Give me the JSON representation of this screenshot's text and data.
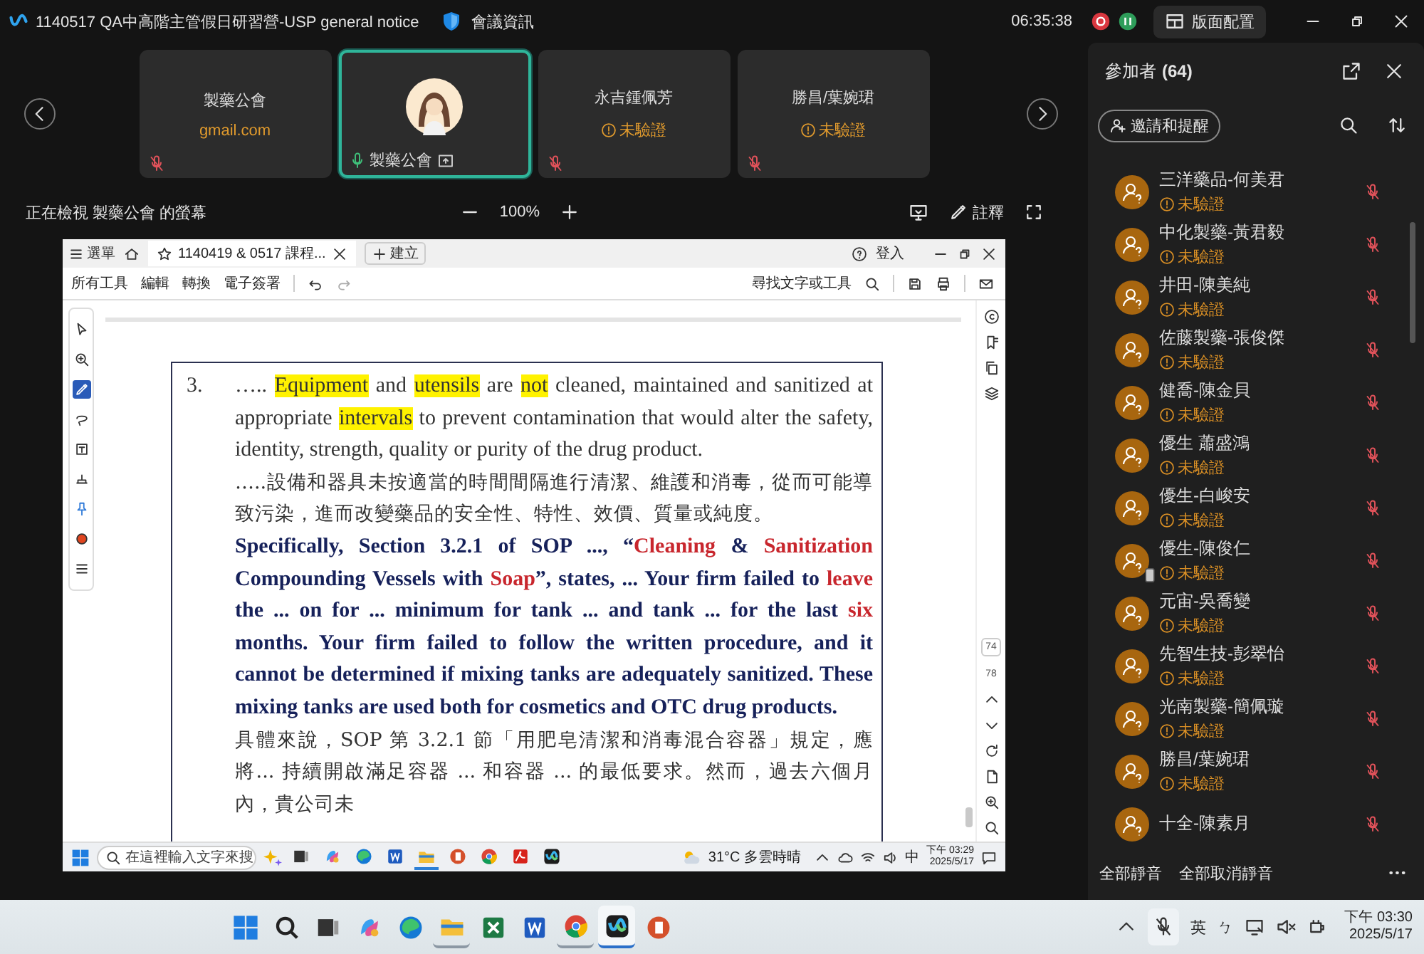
{
  "window": {
    "title": "1140517 QA中高階主管假日研習營-USP general notice",
    "meeting_info": "會議資訊",
    "timer": "06:35:38",
    "layout_button": "版面配置"
  },
  "video_strip": {
    "tiles": [
      {
        "kind": "text",
        "name": "製藥公會",
        "subtitle": "gmail.com",
        "muted": true,
        "speaking": false,
        "sharing": false
      },
      {
        "kind": "avatar",
        "name": "製藥公會",
        "muted": false,
        "speaking": true,
        "sharing": true
      },
      {
        "kind": "text",
        "name": "永吉鍾佩芳",
        "status": "未驗證",
        "muted": true,
        "speaking": false,
        "sharing": false
      },
      {
        "kind": "text",
        "name": "勝昌/葉婉珺",
        "status": "未驗證",
        "muted": true,
        "speaking": false,
        "sharing": false
      }
    ]
  },
  "share_bar": {
    "caption": "正在檢視 製藥公會 的螢幕",
    "zoom": "100%",
    "annotate_button": "註釋"
  },
  "shared_screen": {
    "viewer": {
      "menu": "選單",
      "tab": "1140419 & 0517 課程...",
      "new_tab": "建立",
      "sign_in": "登入",
      "tools": [
        "所有工具",
        "編輯",
        "轉換",
        "電子簽署"
      ],
      "find": "尋找文字或工具",
      "page_numbers": [
        "74",
        "78"
      ],
      "tool_rail": [
        {
          "kind": "cursor",
          "selected": false
        },
        {
          "kind": "zoom",
          "selected": false
        },
        {
          "kind": "pen",
          "selected": true
        },
        {
          "kind": "lasso",
          "selected": false
        },
        {
          "kind": "textbox",
          "selected": false
        },
        {
          "kind": "stamp",
          "selected": false
        },
        {
          "kind": "pin",
          "selected": false
        },
        {
          "kind": "color",
          "selected": false
        },
        {
          "kind": "menu",
          "selected": false
        }
      ]
    },
    "document": {
      "item_number": "3.",
      "paragraphs": [
        {
          "kind": "english",
          "segments": [
            {
              "kind": "plain",
              "text": "….. "
            },
            {
              "kind": "highlight",
              "text": "Equipment"
            },
            {
              "kind": "plain",
              "text": " and "
            },
            {
              "kind": "highlight",
              "text": "utensils"
            },
            {
              "kind": "plain",
              "text": " are "
            },
            {
              "kind": "highlight",
              "text": "not"
            },
            {
              "kind": "plain",
              "text": " cleaned, maintained and sanitized at appropriate "
            },
            {
              "kind": "highlight",
              "text": "intervals"
            },
            {
              "kind": "plain",
              "text": " to prevent contamination that would alter the safety, identity, strength, quality or purity of the drug product."
            }
          ]
        },
        {
          "kind": "chinese",
          "segments": [
            {
              "kind": "plain",
              "text": "…..設備和器具未按適當的時間間隔進行清潔、維護和消毒，從而可能導致污染，進而改變藥品的安全性、特性、效價、質量或純度。"
            }
          ]
        },
        {
          "kind": "emphasis",
          "segments": [
            {
              "kind": "plain",
              "text": "Specifically, Section 3.2.1 of SOP ..., “"
            },
            {
              "kind": "red",
              "text": "Cleaning"
            },
            {
              "kind": "plain",
              "text": " & "
            },
            {
              "kind": "red",
              "text": "Sanitization"
            },
            {
              "kind": "plain",
              "text": " Compounding Vessels with "
            },
            {
              "kind": "red",
              "text": "Soap"
            },
            {
              "kind": "plain",
              "text": "”, states, ... Your firm failed to "
            },
            {
              "kind": "red",
              "text": "leave"
            },
            {
              "kind": "plain",
              "text": " the ... on for ... minimum for tank ... and tank ... for the last "
            },
            {
              "kind": "red",
              "text": "six"
            },
            {
              "kind": "plain",
              "text": " months. Your firm failed to follow the written procedure, and it cannot be determined if mixing tanks are adequately sanitized. These mixing tanks are used both for cosmetics and OTC drug products."
            }
          ]
        },
        {
          "kind": "chinese",
          "segments": [
            {
              "kind": "plain",
              "text": "具體來說，SOP 第 3.2.1 節「用肥皂清潔和消毒混合容器」規定，應將... 持續開啟滿足容器 ... 和容器 ... 的最低要求。然而，過去六個月內，貴公司未"
            }
          ]
        }
      ]
    },
    "taskbar": {
      "search_placeholder": "在這裡輸入文字來搜",
      "weather": "31°C 多雲時晴",
      "ime": "中",
      "time": "下午 03:29",
      "date": "2025/5/17",
      "apps": [
        {
          "kind": "taskview",
          "running": false
        },
        {
          "kind": "assistant",
          "running": false
        },
        {
          "kind": "browser",
          "running": false
        },
        {
          "kind": "word",
          "running": false
        },
        {
          "kind": "files",
          "running": true
        },
        {
          "kind": "slides",
          "running": false
        },
        {
          "kind": "chrome",
          "running": false
        },
        {
          "kind": "pdf",
          "running": false
        },
        {
          "kind": "meeting",
          "running": false
        }
      ]
    }
  },
  "participants": {
    "title": "參加者",
    "count": "(64)",
    "invite_button": "邀請和提醒",
    "items": [
      {
        "name": "三洋藥品-何美君",
        "status": "未驗證",
        "muted": true,
        "on_phone": false
      },
      {
        "name": "中化製藥-黃君毅",
        "status": "未驗證",
        "muted": true,
        "on_phone": false
      },
      {
        "name": "井田-陳美純",
        "status": "未驗證",
        "muted": true,
        "on_phone": false
      },
      {
        "name": "佐藤製藥-張俊傑",
        "status": "未驗證",
        "muted": true,
        "on_phone": false
      },
      {
        "name": "健喬-陳金貝",
        "status": "未驗證",
        "muted": true,
        "on_phone": false
      },
      {
        "name": "優生 蕭盛鴻",
        "status": "未驗證",
        "muted": true,
        "on_phone": false
      },
      {
        "name": "優生-白峻安",
        "status": "未驗證",
        "muted": true,
        "on_phone": false
      },
      {
        "name": "優生-陳俊仁",
        "status": "未驗證",
        "muted": true,
        "on_phone": true
      },
      {
        "name": "元宙-吳喬變",
        "status": "未驗證",
        "muted": true,
        "on_phone": false
      },
      {
        "name": "先智生技-彭翠怡",
        "status": "未驗證",
        "muted": true,
        "on_phone": false
      },
      {
        "name": "光南製藥-簡佩璇",
        "status": "未驗證",
        "muted": true,
        "on_phone": false
      },
      {
        "name": "勝昌/葉婉珺",
        "status": "未驗證",
        "muted": true,
        "on_phone": false
      },
      {
        "name": "十全-陳素月",
        "muted": true,
        "on_phone": false
      }
    ],
    "mute_all": "全部靜音",
    "unmute_all": "全部取消靜音"
  },
  "taskbar": {
    "ime": "英",
    "ime_mode": "ㄅ",
    "time": "下午 03:30",
    "date": "2025/5/17",
    "apps": [
      {
        "kind": "start",
        "running": false,
        "selected": false
      },
      {
        "kind": "search",
        "running": false,
        "selected": false
      },
      {
        "kind": "taskview",
        "running": false,
        "selected": false
      },
      {
        "kind": "assistant",
        "running": false,
        "selected": false
      },
      {
        "kind": "browser",
        "running": false,
        "selected": false
      },
      {
        "kind": "files",
        "running": true,
        "selected": false
      },
      {
        "kind": "spreadsheet",
        "running": false,
        "selected": false
      },
      {
        "kind": "word",
        "running": false,
        "selected": false
      },
      {
        "kind": "chrome",
        "running": true,
        "selected": false
      },
      {
        "kind": "meeting",
        "running": true,
        "selected": true
      },
      {
        "kind": "slides",
        "running": false,
        "selected": false
      }
    ]
  }
}
